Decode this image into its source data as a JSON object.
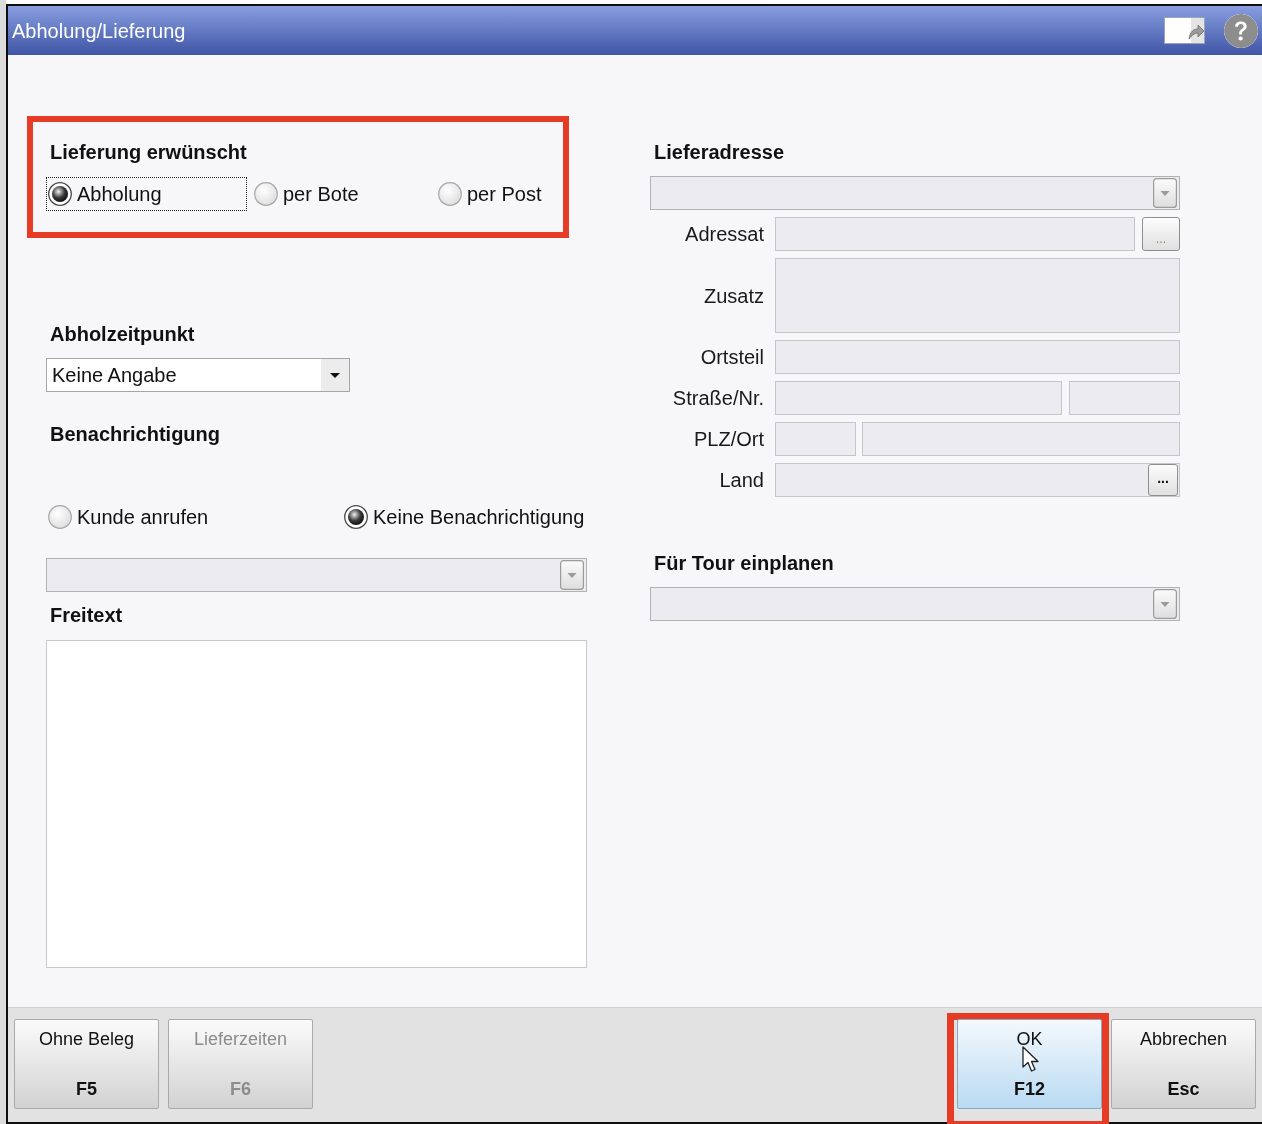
{
  "window": {
    "title": "Abholung/Lieferung"
  },
  "delivery": {
    "heading": "Lieferung erwünscht",
    "highlighted": true,
    "options": [
      {
        "label": "Abholung",
        "selected": true,
        "focused": true
      },
      {
        "label": "per Bote",
        "selected": false,
        "focused": false
      },
      {
        "label": "per Post",
        "selected": false,
        "focused": false
      }
    ]
  },
  "pickup_time": {
    "heading": "Abholzeitpunkt",
    "dropdown": {
      "value": "Keine Angabe",
      "disabled": false
    }
  },
  "notification": {
    "heading": "Benachrichtigung",
    "options": [
      {
        "label": "Kunde anrufen",
        "selected": false
      },
      {
        "label": "Keine Benachrichtigung",
        "selected": true
      }
    ],
    "dropdown": {
      "disabled": true
    }
  },
  "free_text": {
    "heading": "Freitext"
  },
  "delivery_address": {
    "heading": "Lieferadresse",
    "rows": [
      {
        "kind": "select",
        "disabled": true
      },
      {
        "kind": "input_button",
        "label": "Adressat",
        "disabled": true,
        "button": {
          "label": "...",
          "disabled": true
        }
      },
      {
        "kind": "textarea",
        "label": "Zusatz",
        "disabled": true
      },
      {
        "kind": "input",
        "label": "Ortsteil",
        "disabled": true
      },
      {
        "kind": "pair_wide",
        "label": "Straße/Nr.",
        "disabled": true
      },
      {
        "kind": "pair_narrow",
        "label": "PLZ/Ort",
        "disabled": true
      },
      {
        "kind": "input_inner_button",
        "label": "Land",
        "disabled": true,
        "button": {
          "label": "...",
          "disabled": false
        }
      }
    ]
  },
  "tour": {
    "heading": "Für Tour einplanen",
    "dropdown": {
      "disabled": true
    }
  },
  "footer": {
    "left_buttons": [
      {
        "label": "Ohne Beleg",
        "key": "F5",
        "disabled": false,
        "hovered": false,
        "highlighted": false
      },
      {
        "label": "Lieferzeiten",
        "key": "F6",
        "disabled": true,
        "hovered": false,
        "highlighted": false
      }
    ],
    "right_buttons": [
      {
        "label": "OK",
        "key": "F12",
        "disabled": false,
        "hovered": true,
        "highlighted": true
      },
      {
        "label": "Abbrechen",
        "key": "Esc",
        "disabled": false,
        "hovered": false,
        "highlighted": false
      }
    ]
  }
}
